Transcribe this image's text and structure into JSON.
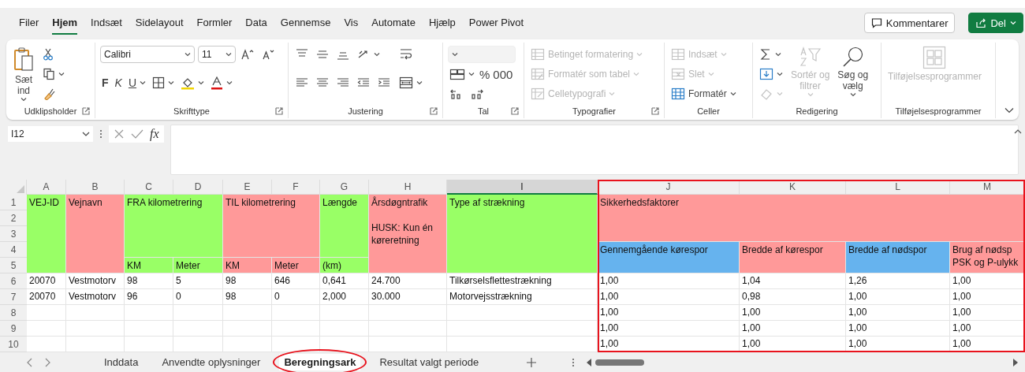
{
  "menu_tabs": [
    {
      "label": "Filer",
      "selected": false
    },
    {
      "label": "Hjem",
      "selected": true
    },
    {
      "label": "Indsæt",
      "selected": false
    },
    {
      "label": "Sidelayout",
      "selected": false
    },
    {
      "label": "Formler",
      "selected": false
    },
    {
      "label": "Data",
      "selected": false
    },
    {
      "label": "Gennemse",
      "selected": false
    },
    {
      "label": "Vis",
      "selected": false
    },
    {
      "label": "Automate",
      "selected": false
    },
    {
      "label": "Hjælp",
      "selected": false
    },
    {
      "label": "Power Pivot",
      "selected": false
    }
  ],
  "header_buttons": [
    {
      "kind": "comments",
      "label": "Kommentarer"
    },
    {
      "kind": "share",
      "label": "Del"
    }
  ],
  "ribbon": {
    "groups": [
      {
        "name": "Udklipsholder",
        "launcher": true,
        "sections": [
          {
            "kind": "large",
            "items": [
              {
                "kind": "paste",
                "label": "Sæt\nind",
                "dropdown": true,
                "disabled": false
              }
            ]
          },
          {
            "kind": "stack",
            "lines": [
              {
                "items": [
                  {
                    "kind": "cut",
                    "dropdown": false,
                    "disabled": false
                  }
                ]
              },
              {
                "items": [
                  {
                    "kind": "copy",
                    "dropdown": true,
                    "disabled": false
                  }
                ]
              },
              {
                "items": [
                  {
                    "kind": "painter",
                    "dropdown": false,
                    "disabled": false
                  }
                ]
              }
            ]
          }
        ]
      },
      {
        "name": "Skrifttype",
        "launcher": true,
        "sections": [
          {
            "kind": "stack",
            "lines": [
              {
                "items": [
                  {
                    "kind": "font",
                    "value": "Calibri",
                    "dropdown": true,
                    "disabled": false
                  },
                  {
                    "kind": "size",
                    "value": "11",
                    "dropdown": true,
                    "disabled": false
                  },
                  {
                    "kind": "grow",
                    "dropdown": false,
                    "disabled": false
                  },
                  {
                    "kind": "shrink",
                    "dropdown": false,
                    "disabled": false
                  }
                ]
              },
              {
                "items": [
                  {
                    "kind": "bold",
                    "label": "F",
                    "dropdown": false,
                    "disabled": false
                  },
                  {
                    "kind": "italic",
                    "label": "K",
                    "dropdown": false,
                    "disabled": false
                  },
                  {
                    "kind": "underline",
                    "label": "U",
                    "dropdown": true,
                    "disabled": false
                  },
                  {
                    "kind": "border",
                    "dropdown": true,
                    "disabled": false
                  },
                  {
                    "kind": "fill",
                    "dropdown": true,
                    "disabled": false
                  },
                  {
                    "kind": "fontcolor",
                    "dropdown": true,
                    "disabled": false
                  }
                ]
              }
            ]
          }
        ]
      },
      {
        "name": "Justering",
        "launcher": true,
        "sections": [
          {
            "kind": "stack",
            "lines": [
              {
                "items": [
                  {
                    "kind": "top",
                    "dropdown": false,
                    "disabled": false
                  },
                  {
                    "kind": "middle",
                    "dropdown": false,
                    "disabled": false
                  },
                  {
                    "kind": "bottom",
                    "dropdown": false,
                    "disabled": false
                  },
                  {
                    "kind": "orientation",
                    "dropdown": true,
                    "disabled": false
                  }
                ]
              },
              {
                "items": [
                  {
                    "kind": "left",
                    "dropdown": false,
                    "disabled": false
                  },
                  {
                    "kind": "center",
                    "dropdown": false,
                    "disabled": false
                  },
                  {
                    "kind": "right",
                    "dropdown": false,
                    "disabled": false
                  },
                  {
                    "kind": "outdent",
                    "dropdown": false,
                    "disabled": false
                  },
                  {
                    "kind": "indent",
                    "dropdown": false,
                    "disabled": false
                  }
                ]
              }
            ]
          },
          {
            "kind": "stack",
            "lines": [
              {
                "items": [
                  {
                    "kind": "wrap",
                    "dropdown": false,
                    "disabled": false
                  }
                ]
              },
              {
                "items": [
                  {
                    "kind": "merge",
                    "dropdown": true,
                    "disabled": false
                  }
                ]
              }
            ]
          }
        ]
      },
      {
        "name": "Tal",
        "launcher": true,
        "sections": [
          {
            "kind": "stack",
            "lines": [
              {
                "items": [
                  {
                    "kind": "format",
                    "dropdown": true,
                    "disabled": true
                  }
                ]
              },
              {
                "items": [
                  {
                    "kind": "accounting",
                    "dropdown": true,
                    "disabled": false
                  },
                  {
                    "kind": "text",
                    "label": "%",
                    "dropdown": false,
                    "disabled": false
                  },
                  {
                    "kind": "text",
                    "label": "000",
                    "dropdown": false,
                    "disabled": false
                  }
                ]
              },
              {
                "items": [
                  {
                    "kind": "decless",
                    "dropdown": false,
                    "disabled": false
                  },
                  {
                    "kind": "decmore",
                    "dropdown": false,
                    "disabled": false
                  }
                ]
              }
            ]
          }
        ]
      },
      {
        "name": "Typografier",
        "launcher": true,
        "sections": [
          {
            "kind": "stack",
            "lines": [
              {
                "items": [
                  {
                    "kind": "conditional",
                    "label": "Betinget formatering",
                    "dropdown": true,
                    "disabled": true
                  }
                ]
              },
              {
                "items": [
                  {
                    "kind": "table",
                    "label": "Formatér som tabel",
                    "dropdown": true,
                    "disabled": true
                  }
                ]
              },
              {
                "items": [
                  {
                    "kind": "cellstyle",
                    "label": "Celletypografi",
                    "dropdown": true,
                    "disabled": true
                  }
                ]
              }
            ]
          }
        ]
      },
      {
        "name": "Celler",
        "launcher": false,
        "sections": [
          {
            "kind": "stack",
            "lines": [
              {
                "items": [
                  {
                    "kind": "insert",
                    "label": "Indsæt",
                    "dropdown": true,
                    "disabled": true
                  }
                ]
              },
              {
                "items": [
                  {
                    "kind": "delete",
                    "label": "Slet",
                    "dropdown": true,
                    "disabled": true
                  }
                ]
              },
              {
                "items": [
                  {
                    "kind": "cellformat",
                    "label": "Formatér",
                    "dropdown": true,
                    "disabled": false
                  }
                ]
              }
            ]
          }
        ]
      },
      {
        "name": "Redigering",
        "launcher": false,
        "sections": [
          {
            "kind": "stack",
            "lines": [
              {
                "items": [
                  {
                    "kind": "sum",
                    "dropdown": true,
                    "disabled": false
                  }
                ]
              },
              {
                "items": [
                  {
                    "kind": "filldown",
                    "dropdown": true,
                    "disabled": false
                  }
                ]
              },
              {
                "items": [
                  {
                    "kind": "clear",
                    "dropdown": true,
                    "disabled": true
                  }
                ]
              }
            ]
          },
          {
            "kind": "large",
            "items": [
              {
                "kind": "sort",
                "label": "Sortér og\nfiltrer",
                "dropdown": true,
                "disabled": true
              },
              {
                "kind": "find",
                "label": "Søg og\nvælg",
                "dropdown": true,
                "disabled": false
              }
            ]
          }
        ]
      },
      {
        "name": "Tilføjelsesprogrammer",
        "launcher": false,
        "sections": [
          {
            "kind": "large",
            "items": [
              {
                "kind": "addins",
                "label": "Tilføjelsesprogrammer",
                "dropdown": false,
                "disabled": true
              }
            ]
          }
        ]
      }
    ]
  },
  "formula_bar": {
    "name_box": "I12",
    "function_label": "fx"
  },
  "sheet": {
    "columns": [
      {
        "label": "A",
        "selected": false,
        "highlighted": false
      },
      {
        "label": "B",
        "selected": false,
        "highlighted": false
      },
      {
        "label": "C",
        "selected": false,
        "highlighted": false
      },
      {
        "label": "D",
        "selected": false,
        "highlighted": false
      },
      {
        "label": "E",
        "selected": false,
        "highlighted": false
      },
      {
        "label": "F",
        "selected": false,
        "highlighted": false
      },
      {
        "label": "G",
        "selected": false,
        "highlighted": false
      },
      {
        "label": "H",
        "selected": false,
        "highlighted": false
      },
      {
        "label": "I",
        "selected": true,
        "highlighted": false
      },
      {
        "label": "J",
        "selected": false,
        "highlighted": true
      },
      {
        "label": "K",
        "selected": false,
        "highlighted": true
      },
      {
        "label": "L",
        "selected": false,
        "highlighted": true
      },
      {
        "label": "M",
        "selected": false,
        "highlighted": true
      }
    ],
    "rows": [
      {
        "number": "1",
        "cells": {
          "A": {
            "text": "VEJ-ID",
            "color": "#99ff66"
          },
          "B": {
            "text": "Vejnavn",
            "color": "#ff9999"
          },
          "C": {
            "text": "FRA kilometrering",
            "color": "#99ff66"
          },
          "E": {
            "text": "TIL kilometrering",
            "color": "#ff9999"
          },
          "G": {
            "text": "Længde",
            "color": "#99ff66"
          },
          "H": {
            "text": "Årsdøgntrafik\n\nHUSK: Kun én\nkøreretning",
            "color": "#ff9999"
          },
          "I": {
            "text": "Type af strækning",
            "color": "#99ff66"
          },
          "J": {
            "text": "Sikkerhedsfaktorer",
            "color": "#ff9999"
          }
        }
      },
      {
        "number": "2"
      },
      {
        "number": "3"
      },
      {
        "number": "4",
        "cells": {
          "J": {
            "text": "Gennemgående kørespor",
            "color": "#66b3ee"
          },
          "K": {
            "text": "Bredde af kørespor",
            "color": "#ff9999"
          },
          "L": {
            "text": "Bredde af nødspor",
            "color": "#66b3ee"
          },
          "M": {
            "text": "Brug af nødsp\nPSK og P-ulykk",
            "color": "#ff9999"
          }
        }
      },
      {
        "number": "5",
        "cells": {
          "C": {
            "text": "KM",
            "color": "#99ff66"
          },
          "D": {
            "text": "Meter",
            "color": "#99ff66"
          },
          "E": {
            "text": "KM",
            "color": "#ff9999"
          },
          "F": {
            "text": "Meter",
            "color": "#ff9999"
          },
          "G": {
            "text": "(km)",
            "color": "#99ff66"
          }
        }
      },
      {
        "number": "6",
        "cells": {
          "A": "20070",
          "B": "Vestmotorv",
          "C": "98",
          "D": "5",
          "E": "98",
          "F": "646",
          "G": "0,641",
          "H": "24.700",
          "I": "Tilkørselsflettestrækning",
          "J": "1,00",
          "K": "1,04",
          "L": "1,26",
          "M": "1,00"
        }
      },
      {
        "number": "7",
        "cells": {
          "A": "20070",
          "B": "Vestmotorv",
          "C": "96",
          "D": "0",
          "E": "98",
          "F": "0",
          "G": "2,000",
          "H": "30.000",
          "I": "Motorvejsstrækning",
          "J": "1,00",
          "K": "0,98",
          "L": "1,00",
          "M": "1,00"
        }
      },
      {
        "number": "8",
        "cells": {
          "J": "1,00",
          "K": "1,00",
          "L": "1,00",
          "M": "1,00"
        }
      },
      {
        "number": "9",
        "cells": {
          "J": "1,00",
          "K": "1,00",
          "L": "1,00",
          "M": "1,00"
        }
      },
      {
        "number": "10",
        "cells": {
          "J": "1,00",
          "K": "1,00",
          "L": "1,00",
          "M": "1,00"
        }
      }
    ]
  },
  "sheet_tabs": [
    {
      "label": "Inddata",
      "selected": false,
      "circled": false
    },
    {
      "label": "Anvendte oplysninger",
      "selected": false,
      "circled": false
    },
    {
      "label": "Beregningsark",
      "selected": true,
      "circled": true
    },
    {
      "label": "Resultat valgt periode",
      "selected": false,
      "circled": false
    }
  ]
}
